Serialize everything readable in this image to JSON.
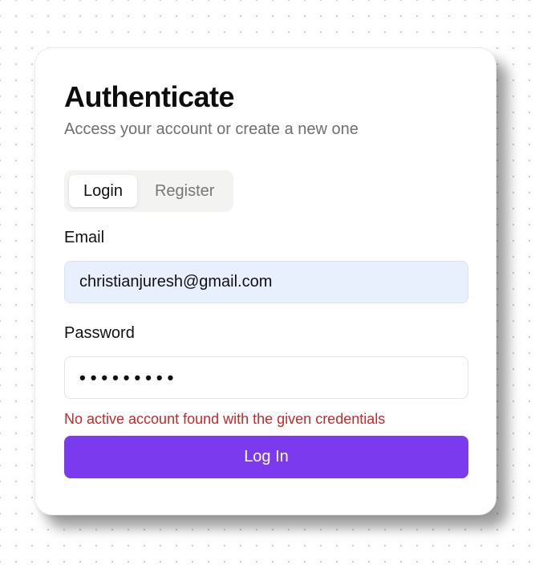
{
  "header": {
    "title": "Authenticate",
    "subtitle": "Access your account or create a new one"
  },
  "tabs": [
    {
      "label": "Login",
      "active": true
    },
    {
      "label": "Register",
      "active": false
    }
  ],
  "form": {
    "email_label": "Email",
    "email_value": "christianjuresh@gmail.com",
    "password_label": "Password",
    "password_value": "•••••••••",
    "error_message": "No active account found with the given credentials",
    "submit_label": "Log In"
  },
  "colors": {
    "accent": "#7b3aed",
    "error": "#c52828",
    "autofill_background": "#e8effd"
  }
}
